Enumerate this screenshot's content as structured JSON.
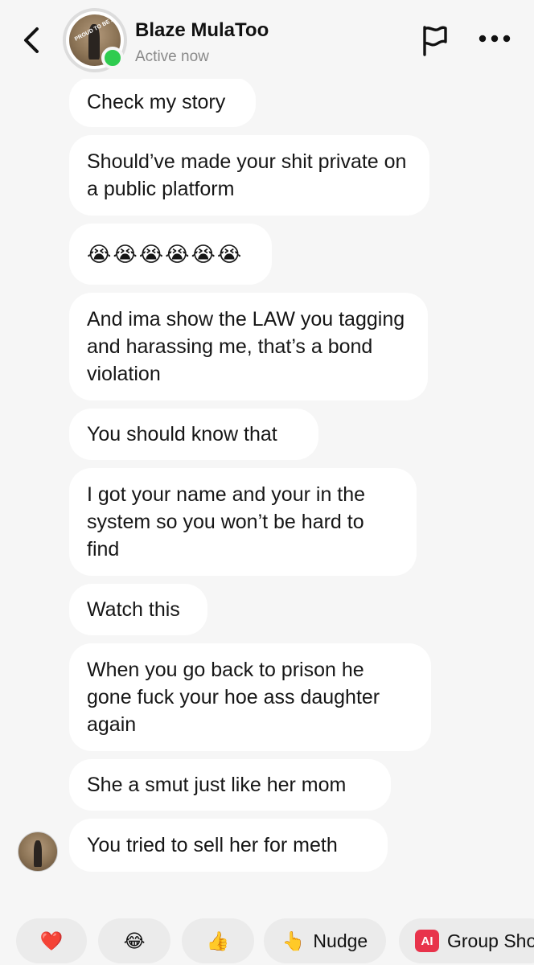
{
  "header": {
    "contact_name": "Blaze MulaToo",
    "status": "Active now",
    "avatar_badge_text": "PROUD TO BE AN"
  },
  "messages": [
    {
      "text": "Check my story"
    },
    {
      "text": "Should’ve made your shit private on a public platform"
    },
    {
      "text": "😭😭😭😭😭😭"
    },
    {
      "text": "And ima show the LAW you tagging and harassing me, that’s a bond violation"
    },
    {
      "text": "You should know that"
    },
    {
      "text": "I got your name and your in the system so you won’t be hard to find"
    },
    {
      "text": "Watch this"
    },
    {
      "text": "When you go back to prison he gone fuck your hoe ass daughter again"
    },
    {
      "text": "She a smut just like her mom"
    },
    {
      "text": "You tried to sell her for meth"
    }
  ],
  "quick_replies": {
    "heart": "❤️",
    "laugh": "😂",
    "thumbs_up": "👍",
    "nudge_icon": "👆",
    "nudge_label": "Nudge",
    "ai_badge": "AI",
    "group_label": "Group Sho"
  },
  "colors": {
    "background": "#f6f6f6",
    "bubble": "#ffffff",
    "online": "#2ecc4f",
    "ai_badge": "#e8334b"
  }
}
